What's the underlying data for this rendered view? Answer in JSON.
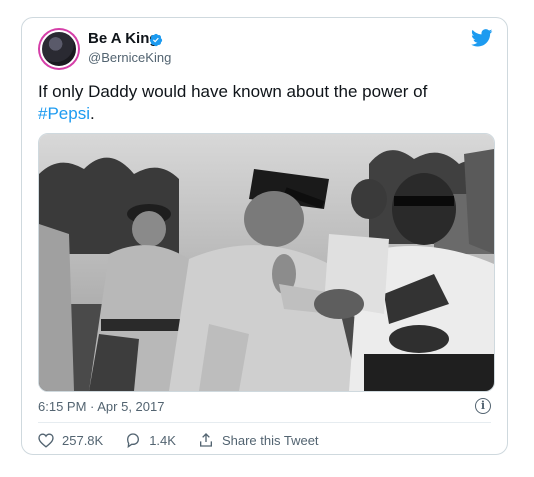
{
  "tweet": {
    "display_name": "Be A King",
    "handle": "@BerniceKing",
    "text_main": "If only Daddy would have known about the power of",
    "hashtag": "#Pepsi",
    "text_end": ".",
    "timestamp": "6:15 PM · Apr 5, 2017",
    "likes": "257.8K",
    "replies": "1.4K",
    "share_label": "Share this Tweet"
  },
  "icons": {
    "verified": "verified-badge-icon",
    "brand": "twitter-bird-icon",
    "info": "info-icon",
    "like": "heart-icon",
    "reply": "reply-icon",
    "share": "share-icon"
  },
  "colors": {
    "accent": "#1d9bf0",
    "secondary_text": "#536471",
    "avatar_ring": "#d53fa8"
  }
}
